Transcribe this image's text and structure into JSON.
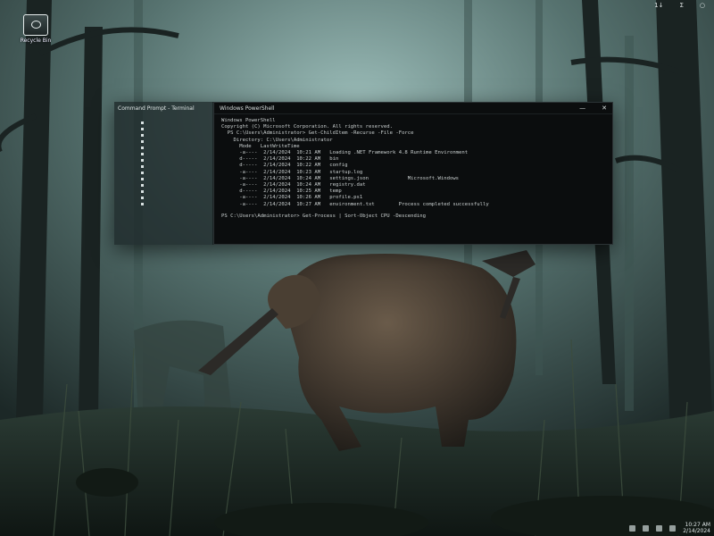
{
  "desktop": {
    "icon_label": "Recycle Bin"
  },
  "top_tray": {
    "item_1": "1↓",
    "item_2": "Σ",
    "item_3": "○"
  },
  "window": {
    "side_title": "Command Prompt - Terminal",
    "tab_title": "Windows PowerShell",
    "min_label": "—",
    "close_label": "✕",
    "lines": [
      "Windows PowerShell",
      "Copyright (C) Microsoft Corporation. All rights reserved.",
      "  PS C:\\Users\\Administrator> Get-ChildItem -Recurse -File -Force",
      "    Directory: C:\\Users\\Administrator",
      "      Mode   LastWriteTime",
      "      -a----  2/14/2024  10:21 AM   Loading .NET Framework 4.8 Runtime Environment",
      "      d-----  2/14/2024  10:22 AM   bin",
      "      d-----  2/14/2024  10:22 AM   config",
      "      -a----  2/14/2024  10:23 AM   startup.log",
      "      -a----  2/14/2024  10:24 AM   settings.json             Microsoft.Windows",
      "      -a----  2/14/2024  10:24 AM   registry.dat",
      "      d-----  2/14/2024  10:25 AM   temp",
      "      -a----  2/14/2024  10:26 AM   profile.ps1",
      "      -a----  2/14/2024  10:27 AM   environment.txt        Process completed successfully"
    ],
    "prompt": "PS C:\\Users\\Administrator> Get-Process | Sort-Object CPU -Descending"
  },
  "taskbar": {
    "time": "10:27 AM",
    "date": "2/14/2024"
  },
  "colors": {
    "terminal_bg": "#0b0d0e",
    "fog": "#6f8f8c"
  }
}
